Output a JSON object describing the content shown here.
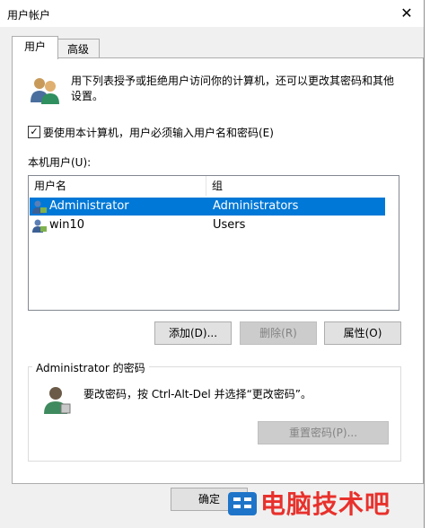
{
  "window": {
    "title": "用户帐户",
    "close_glyph": "✕"
  },
  "tabs": [
    {
      "label": "用户"
    },
    {
      "label": "高级"
    }
  ],
  "intro": {
    "text": "用下列表授予或拒绝用户访问你的计算机，还可以更改其密码和其他设置。"
  },
  "require_login": {
    "label": "要使用本计算机，用户必须输入用户名和密码(E)",
    "checked": true,
    "check_glyph": "✓"
  },
  "local_users": {
    "label": "本机用户(U):",
    "columns": [
      "用户名",
      "组"
    ],
    "rows": [
      {
        "name": "Administrator",
        "group": "Administrators",
        "selected": true
      },
      {
        "name": "win10",
        "group": "Users",
        "selected": false
      }
    ]
  },
  "buttons": {
    "add": "添加(D)...",
    "remove": "删除(R)",
    "properties": "属性(O)"
  },
  "password_group": {
    "title": "Administrator 的密码",
    "text": "要改密码，按 Ctrl-Alt-Del 并选择“更改密码”。",
    "reset_button": "重置密码(P)..."
  },
  "footer": {
    "ok_button": "确定"
  },
  "watermark": {
    "text": "电脑技术吧"
  },
  "colors": {
    "selection": "#0078d7",
    "watermark": "#e8312c"
  }
}
